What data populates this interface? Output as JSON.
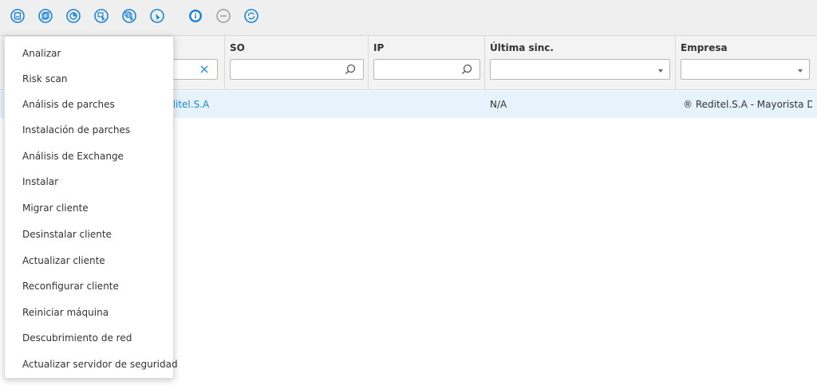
{
  "toolbar": {
    "icons": [
      {
        "name": "save-icon"
      },
      {
        "name": "copy-icon"
      },
      {
        "name": "report-icon"
      },
      {
        "name": "select-device-icon"
      },
      {
        "name": "select-all-icon"
      },
      {
        "name": "pointer-icon"
      },
      {
        "name": "info-icon"
      },
      {
        "name": "remove-icon"
      },
      {
        "name": "refresh-icon"
      }
    ]
  },
  "columns": {
    "so": {
      "title": "SO",
      "value": ""
    },
    "ip": {
      "title": "IP",
      "value": ""
    },
    "last_sync": {
      "title": "Última sinc.",
      "value": ""
    },
    "company": {
      "title": "Empresa",
      "value": ""
    }
  },
  "row": {
    "name": "editel.S.A",
    "last_sync": "N/A",
    "company": "® Reditel.S.A - Mayorista De..."
  },
  "menu": {
    "items": [
      "Analizar",
      "Risk scan",
      "Análisis de parches",
      "Instalación de parches",
      "Análisis de Exchange",
      "Instalar",
      "Migrar cliente",
      "Desinstalar cliente",
      "Actualizar cliente",
      "Reconfigurar cliente",
      "Reiniciar máquina",
      "Descubrimiento de red",
      "Actualizar servidor de seguridad"
    ]
  },
  "colors": {
    "accent": "#1a85d6",
    "row_selected": "#e6f3fc",
    "toolbar_bg": "#efefef"
  }
}
